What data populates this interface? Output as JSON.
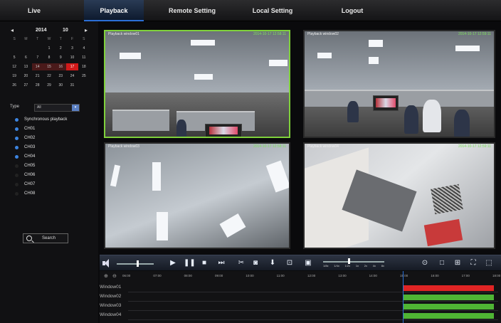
{
  "nav": {
    "items": [
      "Live",
      "Playback",
      "Remote Setting",
      "Local Setting",
      "Logout"
    ],
    "active": "Playback"
  },
  "calendar": {
    "year": "2014",
    "month": "10",
    "weekdays": [
      "S",
      "M",
      "T",
      "W",
      "T",
      "F",
      "S"
    ],
    "days": [
      "",
      "",
      "",
      "1",
      "2",
      "3",
      "4",
      "5",
      "6",
      "7",
      "8",
      "9",
      "10",
      "11",
      "12",
      "13",
      "14",
      "15",
      "16",
      "17",
      "18",
      "19",
      "20",
      "21",
      "22",
      "23",
      "24",
      "25",
      "26",
      "27",
      "28",
      "29",
      "30",
      "31",
      ""
    ],
    "selected_day": "17",
    "recorded_days": [
      "14",
      "15",
      "16",
      "17"
    ]
  },
  "filter": {
    "type_label": "Type",
    "type_value": "All"
  },
  "channels": [
    {
      "label": "Synchronous playback",
      "checked": true
    },
    {
      "label": "CH01",
      "checked": true
    },
    {
      "label": "CH02",
      "checked": true
    },
    {
      "label": "CH03",
      "checked": true
    },
    {
      "label": "CH04",
      "checked": true
    },
    {
      "label": "CH05",
      "checked": false
    },
    {
      "label": "CH06",
      "checked": false
    },
    {
      "label": "CH07",
      "checked": false
    },
    {
      "label": "CH08",
      "checked": false
    }
  ],
  "search_label": "Search",
  "windows": [
    {
      "label": "Playback window01",
      "time": "2014-10-17 12:58:11"
    },
    {
      "label": "Playback window02",
      "time": "2014-10-17 12:59:11"
    },
    {
      "label": "Playback window03",
      "time": "2014-10-17 12:58:11"
    },
    {
      "label": "Playback window04",
      "time": "2014-10-17 12:59:11"
    }
  ],
  "controls": {
    "speed_marks": [
      "1/8x",
      "1/4x",
      "1/2x",
      "1x",
      "2x",
      "4x",
      "8x"
    ],
    "speed_value_percent": 42,
    "volume_percent": 55
  },
  "timeline": {
    "hours": [
      "06:00",
      "07:00",
      "08:00",
      "09:00",
      "10:00",
      "11:00",
      "12:00",
      "13:00",
      "14:00",
      "15:00",
      "16:00",
      "17:00",
      "18:00"
    ],
    "tracks": [
      "Window01",
      "Window02",
      "Window03",
      "Window04"
    ],
    "colors": {
      "alarm": "#e02424",
      "normal": "#4fb434"
    }
  }
}
